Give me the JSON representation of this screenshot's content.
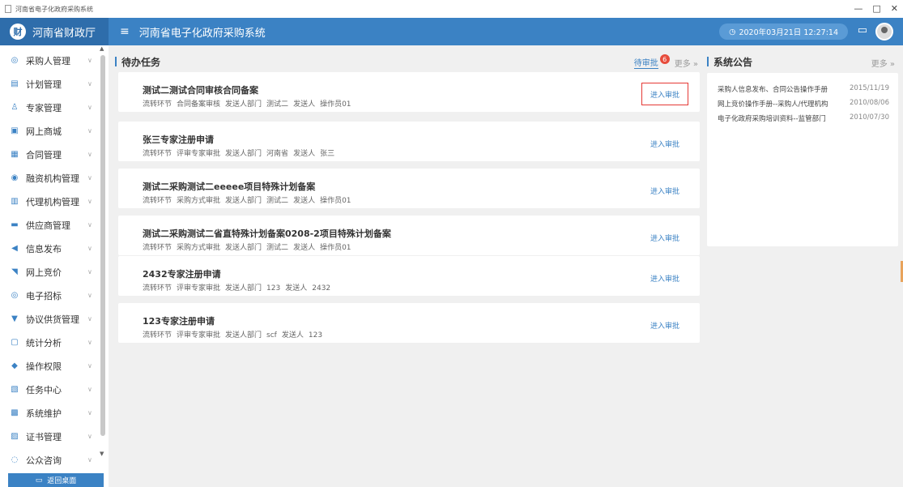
{
  "window": {
    "title": "河南省电子化政府采购系统",
    "controls": [
      "—",
      "□",
      "✕"
    ]
  },
  "header": {
    "brand": "河南省财政厅",
    "logo_text": "财",
    "menu_icon": "≡",
    "system_title": "河南省电子化政府采购系统",
    "datetime": "2020年03月21日 12:27:14",
    "message_icon": "▭"
  },
  "sidebar": {
    "items": [
      {
        "icon": "◎",
        "label": "采购人管理"
      },
      {
        "icon": "▤",
        "label": "计划管理"
      },
      {
        "icon": "♙",
        "label": "专家管理"
      },
      {
        "icon": "▣",
        "label": "网上商城"
      },
      {
        "icon": "▦",
        "label": "合同管理"
      },
      {
        "icon": "◉",
        "label": "融资机构管理"
      },
      {
        "icon": "▥",
        "label": "代理机构管理"
      },
      {
        "icon": "▬",
        "label": "供应商管理"
      },
      {
        "icon": "◀",
        "label": "信息发布"
      },
      {
        "icon": "◥",
        "label": "网上竞价"
      },
      {
        "icon": "◎",
        "label": "电子招标"
      },
      {
        "icon": "▼",
        "label": "协议供货管理"
      },
      {
        "icon": "▢",
        "label": "统计分析"
      },
      {
        "icon": "◆",
        "label": "操作权限"
      },
      {
        "icon": "▧",
        "label": "任务中心"
      },
      {
        "icon": "▩",
        "label": "系统维护"
      },
      {
        "icon": "▨",
        "label": "证书管理"
      },
      {
        "icon": "◌",
        "label": "公众咨询"
      }
    ],
    "chevron": "∨",
    "back_button": "返回桌面"
  },
  "tasks": {
    "section_title": "待办任务",
    "tab_pending": "待审批",
    "badge": "6",
    "more": "更多 »",
    "enter_label": "进入审批",
    "items": [
      {
        "title": "测试二测试合同审核合同备案",
        "step_label": "流转环节",
        "step": "合同备案审核",
        "dept_label": "发送人部门",
        "dept": "测试二",
        "sender_label": "发送人",
        "sender": "操作员01"
      },
      {
        "title": "张三专家注册申请",
        "step_label": "流转环节",
        "step": "评审专家审批",
        "dept_label": "发送人部门",
        "dept": "河南省",
        "sender_label": "发送人",
        "sender": "张三"
      },
      {
        "title": "测试二采购测试二eeeee项目特殊计划备案",
        "step_label": "流转环节",
        "step": "采购方式审批",
        "dept_label": "发送人部门",
        "dept": "测试二",
        "sender_label": "发送人",
        "sender": "操作员01"
      },
      {
        "title": "测试二采购测试二省直特殊计划备案0208-2项目特殊计划备案",
        "step_label": "流转环节",
        "step": "采购方式审批",
        "dept_label": "发送人部门",
        "dept": "测试二",
        "sender_label": "发送人",
        "sender": "操作员01"
      },
      {
        "title": "2432专家注册申请",
        "step_label": "流转环节",
        "step": "评审专家审批",
        "dept_label": "发送人部门",
        "dept": "123",
        "sender_label": "发送人",
        "sender": "2432"
      },
      {
        "title": "123专家注册申请",
        "step_label": "流转环节",
        "step": "评审专家审批",
        "dept_label": "发送人部门",
        "dept": "scf",
        "sender_label": "发送人",
        "sender": "123"
      }
    ]
  },
  "notices": {
    "section_title": "系统公告",
    "more": "更多 »",
    "items": [
      {
        "title": "采购人信息发布、合同公告操作手册",
        "date": "2015/11/19"
      },
      {
        "title": "网上竞价操作手册--采购人/代理机构",
        "date": "2010/08/06"
      },
      {
        "title": "电子化政府采购培训资料--监管部门",
        "date": "2010/07/30"
      }
    ]
  },
  "colors": {
    "primary": "#3b82c4",
    "brand_bg": "#2e6dab",
    "badge": "#e74c3c",
    "highlight_box": "#e53935"
  }
}
